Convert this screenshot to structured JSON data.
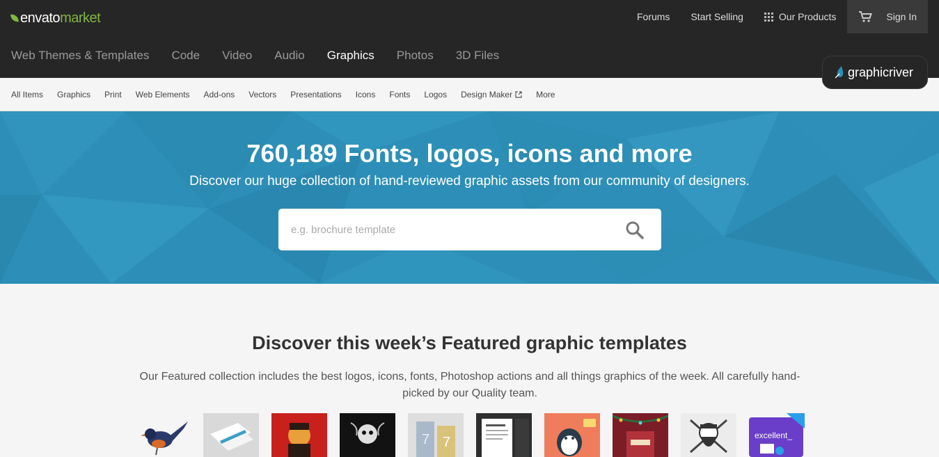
{
  "brand": {
    "word1": "envato",
    "word2": "market"
  },
  "top_links": {
    "forums": "Forums",
    "start_selling": "Start Selling",
    "our_products": "Our Products",
    "sign_in": "Sign In"
  },
  "categories": [
    {
      "label": "Web Themes & Templates"
    },
    {
      "label": "Code"
    },
    {
      "label": "Video"
    },
    {
      "label": "Audio"
    },
    {
      "label": "Graphics",
      "active": true
    },
    {
      "label": "Photos"
    },
    {
      "label": "3D Files"
    }
  ],
  "site_badge": "graphicriver",
  "subnav": [
    "All Items",
    "Graphics",
    "Print",
    "Web Elements",
    "Add-ons",
    "Vectors",
    "Presentations",
    "Icons",
    "Fonts",
    "Logos",
    "Design Maker",
    "More"
  ],
  "hero": {
    "title": "760,189 Fonts, logos, icons and more",
    "subtitle": "Discover our huge collection of hand-reviewed graphic assets from our community of designers.",
    "search_placeholder": "e.g. brochure template"
  },
  "featured": {
    "title": "Discover this week’s Featured graphic templates",
    "description": "Our Featured collection includes the best logos, icons, fonts, Photoshop actions and all things graphics of the week. All carefully hand-picked by our Quality team."
  },
  "colors": {
    "topbar": "#262626",
    "hero": "#2d8fb7",
    "accent_green": "#82b541"
  }
}
